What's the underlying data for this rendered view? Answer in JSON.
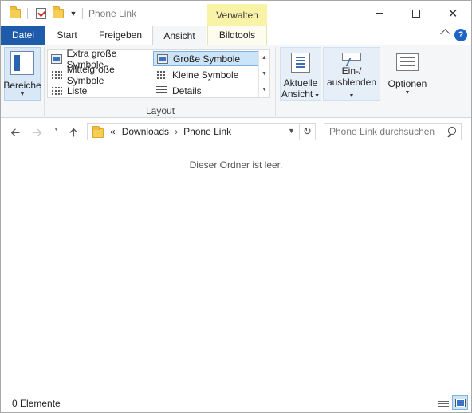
{
  "window": {
    "title": "Phone Link",
    "context_tab": "Verwalten"
  },
  "tabs": {
    "datei": "Datei",
    "start": "Start",
    "freigeben": "Freigeben",
    "ansicht": "Ansicht",
    "bildtools": "Bildtools"
  },
  "ribbon": {
    "bereiche": "Bereiche",
    "layout_items": {
      "extra_large": "Extra große Symbole",
      "large": "Große Symbole",
      "medium": "Mittelgroße Symbole",
      "small": "Kleine Symbole",
      "list": "Liste",
      "details": "Details"
    },
    "layout_group": "Layout",
    "aktuelle_ansicht_line1": "Aktuelle",
    "aktuelle_ansicht_line2": "Ansicht",
    "einaus_line1": "Ein-/",
    "einaus_line2": "ausblenden",
    "optionen": "Optionen"
  },
  "address": {
    "overflow": "«",
    "crumbs": [
      "Downloads",
      "Phone Link"
    ],
    "separator": "›",
    "search_placeholder": "Phone Link durchsuchen"
  },
  "content": {
    "empty_message": "Dieser Ordner ist leer."
  },
  "status": {
    "item_count": "0 Elemente"
  },
  "colors": {
    "accent": "#1e5bab",
    "context_tab": "#f9f3a8",
    "selection": "#cce4f7"
  }
}
